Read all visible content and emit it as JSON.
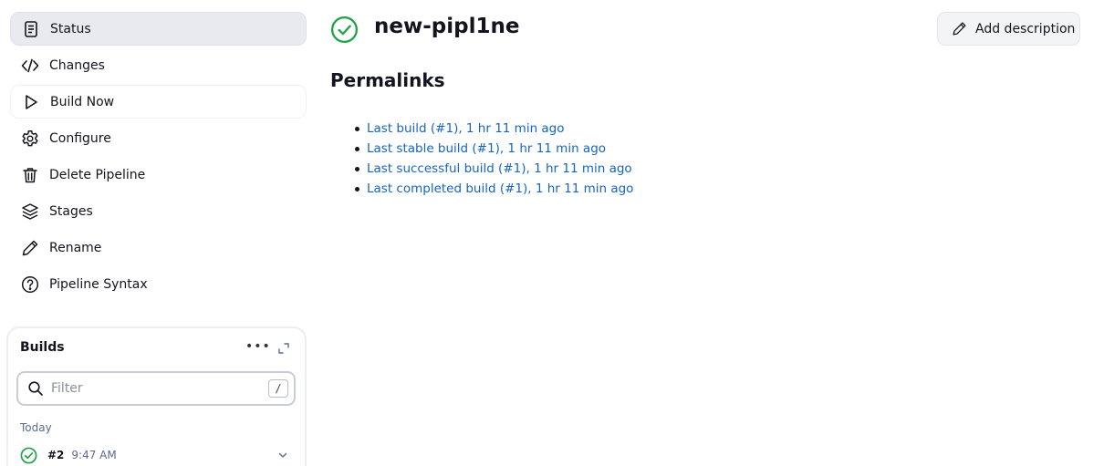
{
  "sidebar": {
    "items": [
      {
        "label": "Status",
        "icon": "document-icon"
      },
      {
        "label": "Changes",
        "icon": "code-icon"
      },
      {
        "label": "Build Now",
        "icon": "play-icon"
      },
      {
        "label": "Configure",
        "icon": "gear-icon"
      },
      {
        "label": "Delete Pipeline",
        "icon": "trash-icon"
      },
      {
        "label": "Stages",
        "icon": "layers-icon"
      },
      {
        "label": "Rename",
        "icon": "pencil-icon"
      },
      {
        "label": "Pipeline Syntax",
        "icon": "help-icon"
      }
    ]
  },
  "builds": {
    "title": "Builds",
    "more": "•••",
    "filter_placeholder": "Filter",
    "filter_shortcut": "/",
    "group_label": "Today",
    "rows": [
      {
        "number": "#2",
        "time": "9:47 AM",
        "status": "success"
      }
    ]
  },
  "main": {
    "title": "new-pipl1ne",
    "add_description_label": "Add description",
    "section_title": "Permalinks",
    "permalinks": [
      "Last build (#1), 1 hr 11 min ago",
      "Last stable build (#1), 1 hr 11 min ago",
      "Last successful build (#1), 1 hr 11 min ago",
      "Last completed build (#1), 1 hr 11 min ago"
    ]
  },
  "colors": {
    "success": "#1ea446",
    "link": "#1565c0",
    "active_bg": "#e8eaf0"
  }
}
